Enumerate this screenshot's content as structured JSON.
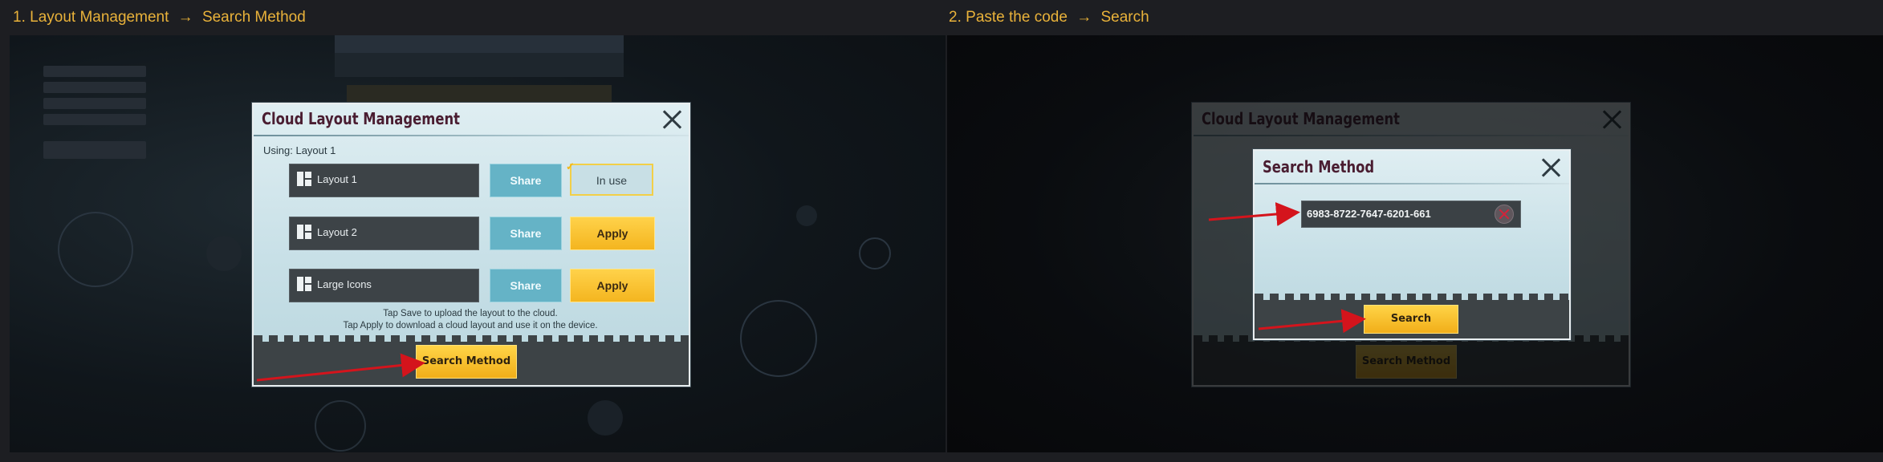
{
  "steps": [
    {
      "number": "1.",
      "from": "Layout Management",
      "arrow": "→",
      "to": "Search Method"
    },
    {
      "number": "2.",
      "from": "Paste the code",
      "arrow": "→",
      "to": "Search"
    }
  ],
  "cloud_dialog": {
    "title": "Cloud Layout Management",
    "using": "Using: Layout 1",
    "layouts": [
      {
        "name": "Layout 1",
        "share": "Share",
        "action": "In use",
        "in_use": true
      },
      {
        "name": "Layout 2",
        "share": "Share",
        "action": "Apply",
        "in_use": false
      },
      {
        "name": "Large Icons",
        "share": "Share",
        "action": "Apply",
        "in_use": false
      }
    ],
    "info_line1": "Tap Save to upload the layout to the cloud.",
    "info_line2": "Tap Apply to download a cloud layout and use it on the device.",
    "search_method_button": "Search Method"
  },
  "search_dialog": {
    "title": "Search Method",
    "code": "6983-8722-7647-6201-661",
    "search_button": "Search"
  },
  "background_dialog": {
    "title": "Cloud Layout Management",
    "button": "Search Method"
  },
  "colors": {
    "caption": "#e9b23a",
    "dialog_title": "#4a1d31",
    "arrow_red": "#d4141c",
    "button_yellow": "#f4b51f",
    "share_blue": "#65b3c6"
  },
  "icons": [
    "close-icon",
    "layout-grid-icon",
    "check-icon",
    "clear-icon",
    "red-arrow-icon"
  ]
}
